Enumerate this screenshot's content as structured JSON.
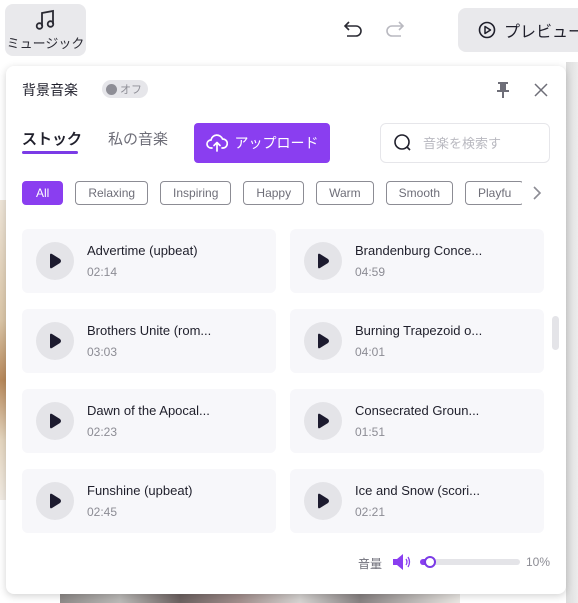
{
  "toolbar": {
    "music_tab": {
      "label": "ミュージック",
      "icon": "music-note-icon"
    },
    "undo_icon": "undo-icon",
    "redo_icon": "redo-icon",
    "preview_button": {
      "label": "プレビュー",
      "icon": "play-circle-icon"
    }
  },
  "panel": {
    "title": "背景音楽",
    "bg_toggle": {
      "label": "オフ",
      "state": "off"
    },
    "pin_icon": "pin-icon",
    "close_icon": "close-icon",
    "tabs": [
      {
        "label": "ストック",
        "active": true
      },
      {
        "label": "私の音楽",
        "active": false
      }
    ],
    "upload_button": {
      "label": "アップロード",
      "icon": "cloud-upload-icon"
    },
    "search": {
      "placeholder": "音楽を検索す",
      "value": ""
    },
    "categories": [
      {
        "label": "All",
        "active": true
      },
      {
        "label": "Relaxing",
        "active": false
      },
      {
        "label": "Inspiring",
        "active": false
      },
      {
        "label": "Happy",
        "active": false
      },
      {
        "label": "Warm",
        "active": false
      },
      {
        "label": "Smooth",
        "active": false
      },
      {
        "label": "Playfu",
        "active": false
      }
    ],
    "tracks": [
      {
        "title": "Advertime (upbeat)",
        "duration": "02:14"
      },
      {
        "title": "Brandenburg Conce...",
        "duration": "04:59"
      },
      {
        "title": "Brothers Unite (rom...",
        "duration": "03:03"
      },
      {
        "title": "Burning Trapezoid o...",
        "duration": "04:01"
      },
      {
        "title": "Dawn of the Apocal...",
        "duration": "02:23"
      },
      {
        "title": "Consecrated Groun...",
        "duration": "01:51"
      },
      {
        "title": "Funshine (upbeat)",
        "duration": "02:45"
      },
      {
        "title": "Ice and Snow (scori...",
        "duration": "02:21"
      }
    ],
    "volume": {
      "label": "音量",
      "value_percent": 10,
      "display": "10%"
    }
  },
  "colors": {
    "accent": "#8a3ef0",
    "card_bg": "#f7f7fa",
    "muted_text": "#8c8c94"
  }
}
